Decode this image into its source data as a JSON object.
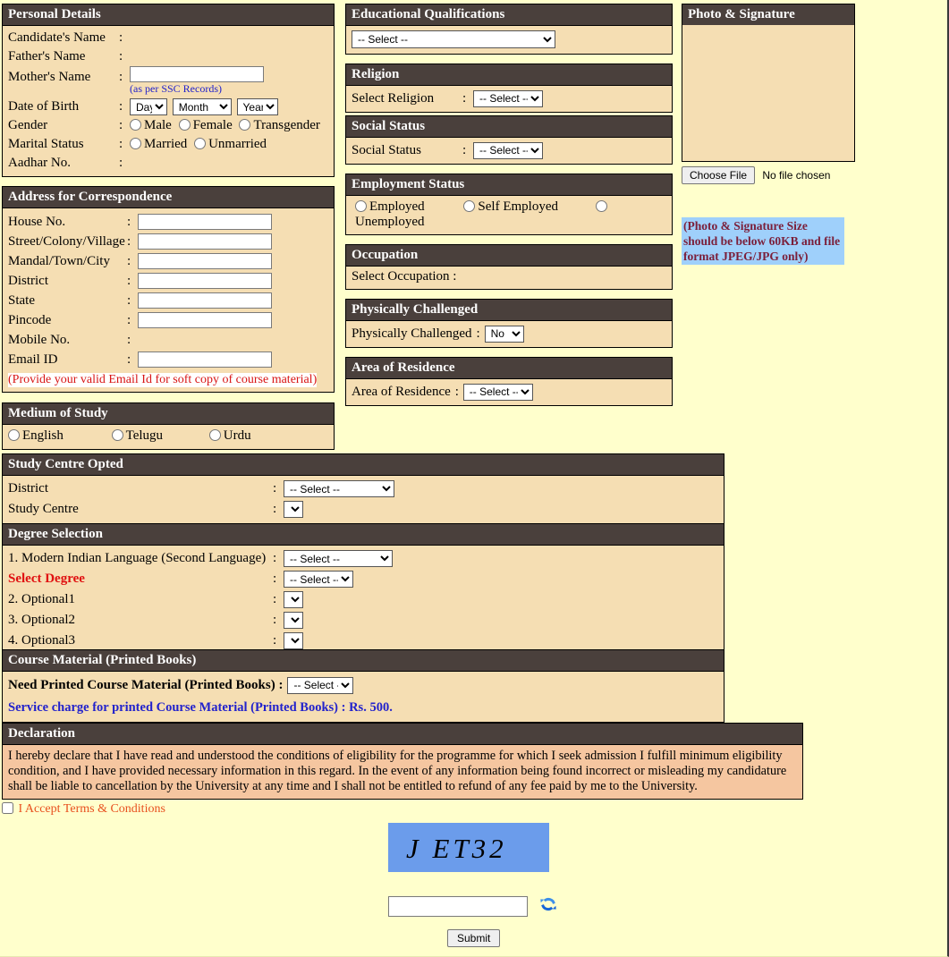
{
  "personal": {
    "title": "Personal Details",
    "fields": [
      {
        "label": "Candidate's Name",
        "colon": ":"
      },
      {
        "label": "Father's Name",
        "colon": ":"
      },
      {
        "label": "Mother's Name",
        "colon": ":",
        "hint": "(as per SSC Records)"
      },
      {
        "label": "Date of Birth",
        "colon": ":"
      },
      {
        "label": "Gender",
        "colon": ":"
      },
      {
        "label": "Marital Status",
        "colon": ":"
      },
      {
        "label": "Aadhar No.",
        "colon": ":"
      }
    ],
    "dob": {
      "day": "Day",
      "month": "Month",
      "year": "Year"
    },
    "gender_options": [
      "Male",
      "Female",
      "Transgender"
    ],
    "marital_options": [
      "Married",
      "Unmarried"
    ]
  },
  "address": {
    "title": "Address for Correspondence",
    "fields": [
      {
        "label": "House No.",
        "colon": ":",
        "value": ""
      },
      {
        "label": "Street/Colony/Village",
        "colon": ":",
        "value": ""
      },
      {
        "label": "Mandal/Town/City",
        "colon": ":",
        "value": ""
      },
      {
        "label": "District",
        "colon": ":",
        "value": ""
      },
      {
        "label": "State",
        "colon": ":",
        "value": ""
      },
      {
        "label": "Pincode",
        "colon": ":",
        "value": ""
      },
      {
        "label": "Mobile No.",
        "colon": ":",
        "value": ""
      },
      {
        "label": "Email ID",
        "colon": ":",
        "value": ""
      }
    ],
    "note": "(Provide your valid Email Id for soft copy of course material)"
  },
  "medium": {
    "title": "Medium of Study",
    "options": [
      "English",
      "Telugu",
      "Urdu"
    ]
  },
  "education": {
    "title": "Educational Qualifications",
    "selected": "-- Select --"
  },
  "religion": {
    "title": "Religion",
    "label": "Select Religion",
    "colon": ":",
    "selected": "-- Select --"
  },
  "social_status": {
    "title": "Social Status",
    "label": "Social Status",
    "colon": ":",
    "selected": "-- Select --"
  },
  "employment": {
    "title": "Employment Status",
    "options": [
      "Employed",
      "Self Employed",
      "Unemployed"
    ]
  },
  "occupation": {
    "title": "Occupation",
    "label": "Select Occupation :"
  },
  "physically_challenged": {
    "title": "Physically Challenged",
    "label": "Physically Challenged",
    "colon": ":",
    "selected": "No"
  },
  "area_of_residence": {
    "title": "Area of Residence",
    "label": "Area of Residence",
    "colon": ":",
    "selected": "-- Select --"
  },
  "photo": {
    "title": "Photo & Signature",
    "choose_file_label": "Choose File",
    "file_status": "No file chosen",
    "note": "(Photo & Signature Size should be below 60KB and file format JPEG/JPG only)"
  },
  "study_centre": {
    "title": "Study Centre Opted",
    "rows": [
      {
        "label": "District",
        "colon": ":",
        "selected": "-- Select --"
      },
      {
        "label": "Study Centre",
        "colon": ":",
        "selected": ""
      }
    ]
  },
  "degree": {
    "title": "Degree Selection",
    "rows": [
      {
        "label": "1. Modern Indian Language (Second Language)",
        "colon": ":",
        "selected": "-- Select --"
      },
      {
        "label": "Select Degree",
        "colon": ":",
        "selected": "-- Select --"
      },
      {
        "label": "2. Optional1",
        "colon": ":",
        "selected": ""
      },
      {
        "label": "3. Optional2",
        "colon": ":",
        "selected": ""
      },
      {
        "label": "4. Optional3",
        "colon": ":",
        "selected": ""
      }
    ]
  },
  "course_material": {
    "title": "Course Material (Printed Books)",
    "label": "Need Printed Course Material (Printed Books) :",
    "selected": "-- Select --",
    "service_charge": "Service charge for printed Course Material (Printed Books) : Rs. 500."
  },
  "declaration": {
    "title": "Declaration",
    "text": "I hereby declare that I have read and understood the conditions of eligibility for the programme for which I seek admission I fulfill minimum eligibility condition, and I have provided necessary information in this regard. In the event of any information being found incorrect or misleading my candidature shall be liable to cancellation by the University at any time and I shall not be entitled to refund of any fee paid by me to the University.",
    "accept_label": "I Accept Terms & Conditions"
  },
  "captcha": {
    "code": "J ET32",
    "input_value": "",
    "refresh_icon": "refresh-icon",
    "submit_label": "Submit"
  },
  "colors": {
    "page_bg": "#ffffcc",
    "panel_bg": "#f5deb3",
    "header_bg": "#4a403c",
    "declaration_bg": "#f5c6a0",
    "note_highlight": "#9fd0fb",
    "captcha_bg": "#6b9ceb",
    "accent_blue": "#2222cc",
    "accent_red": "#d81414",
    "accent_orange": "#e8501e"
  }
}
